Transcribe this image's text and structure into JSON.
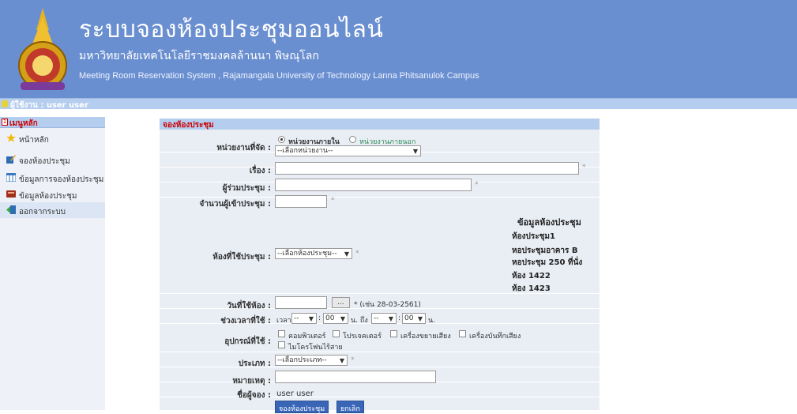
{
  "header": {
    "title": "ระบบจองห้องประชุมออนไลน์",
    "subtitle": "มหาวิทยาลัยเทคโนโลยีราชมงคลล้านนา พิษณุโลก",
    "english": "Meeting Room Reservation System , Rajamangala University of Technology Lanna Phitsanulok Campus",
    "logo_icon": "university-seal-icon"
  },
  "userbar": {
    "label": "ผู้ใช้งาน : user user"
  },
  "sidebar": {
    "heading": "เมนูหลัก",
    "items": [
      {
        "label": "หน้าหลัก",
        "icon": "star-icon"
      },
      {
        "label": "จองห้องประชุม",
        "icon": "edit-icon"
      },
      {
        "label": "ข้อมูลการจองห้องประชุม",
        "icon": "table-icon"
      },
      {
        "label": "ข้อมูลห้องประชุม",
        "icon": "room-icon"
      },
      {
        "label": "ออกจากระบบ",
        "icon": "logout-icon"
      }
    ]
  },
  "form": {
    "heading": "จองห้องประชุม",
    "org_label": "หน่วยงานที่จัด :",
    "org_radio_internal": "หน่วยงานภายใน",
    "org_radio_external": "หน่วยงานภายนอก",
    "org_select": "--เลือกหน่วยงาน--",
    "subject_label": "เรื่อง :",
    "attendees_label": "ผู้ร่วมประชุม :",
    "count_label": "จำนวนผู้เข้าประชุม :",
    "room_label": "ห้องที่ใช้ประชุม :",
    "room_select": "--เลือกห้องประชุม--",
    "room_info_title": "ข้อมูลห้องประชุม",
    "rooms": [
      "ห้องประชุม1",
      "หอประชุมอาคาร B",
      "หอประชุม 250 ที่นั่ง",
      "ห้อง 1422",
      "ห้อง 1423"
    ],
    "date_label": "วันที่ใช้ห้อง :",
    "date_button": "...",
    "date_hint": "* (เช่น 28-03-2561)",
    "time_label": "ช่วงเวลาที่ใช้ :",
    "time_prefix": "เวลา",
    "time_hour_start": "--",
    "time_min_start": "00",
    "time_unit_to": "น. ถึง",
    "time_hour_end": "--",
    "time_min_end": "00",
    "time_unit": "น.",
    "equipment_label": "อุปกรณ์ที่ใช้ :",
    "equipment": [
      "คอมพิวเตอร์",
      "โปรเจคเตอร์",
      "เครื่องขยายเสียง",
      "เครื่องบันทึกเสียง",
      "ไมโครโฟนไร้สาย"
    ],
    "type_label": "ประเภท :",
    "type_select": "--เลือกประเภท--",
    "note_label": "หมายเหตุ :",
    "booker_label": "ชื่อผู้จอง :",
    "booker_value": "user user",
    "submit": "จองห้องประชุม",
    "cancel": "ยกเลิก",
    "colon": ":",
    "star": "*"
  }
}
